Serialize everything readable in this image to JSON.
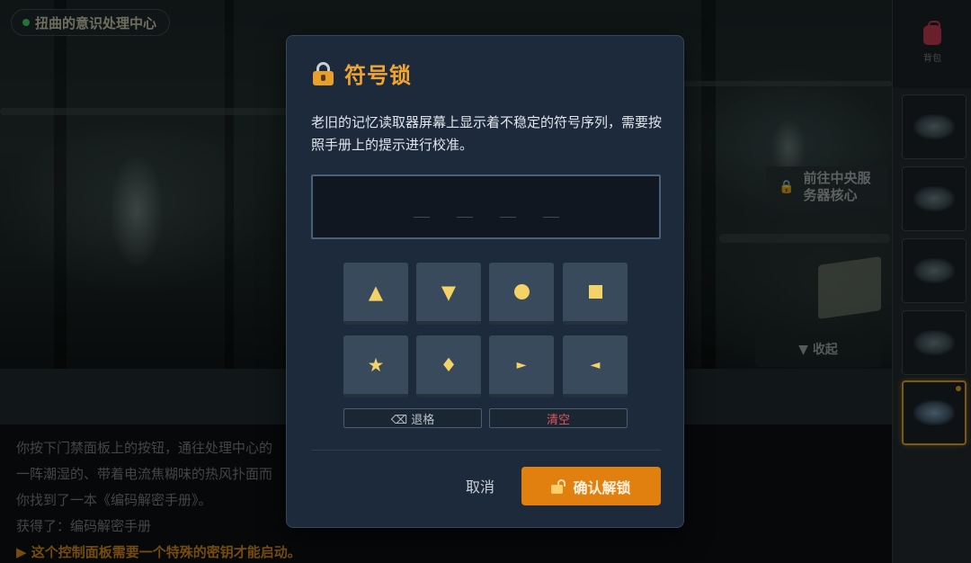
{
  "location": {
    "name": "扭曲的意识处理中心"
  },
  "goto": {
    "label_line1": "前往中央服",
    "label_line2": "务器核心"
  },
  "collapse": {
    "label": "▼ 收起"
  },
  "story": {
    "lines": [
      "你按下门禁面板上的按钮，通往处理中心的",
      "一阵潮湿的、带着电流焦糊味的热风扑面而",
      "你找到了一本《编码解密手册》。",
      "获得了：编码解密手册",
      "▶ 这个控制面板需要一个特殊的密钥才能启动。"
    ]
  },
  "sidebar": {
    "bag_label": "背包"
  },
  "modal": {
    "title": "符号锁",
    "description": "老旧的记忆读取器屏幕上显示着不稳定的符号序列，需要按照手册上的提示进行校准。",
    "keys": [
      "▲",
      "▼",
      "●",
      "■",
      "★",
      "♦",
      "►",
      "◄"
    ],
    "backspace_label": "⌫ 退格",
    "clear_label": "清空",
    "cancel_label": "取消",
    "confirm_label": "确认解锁"
  },
  "colors": {
    "accent": "#f0a431",
    "confirm": "#e17f0f",
    "symbol": "#f3d266",
    "clear": "#e0555e"
  }
}
